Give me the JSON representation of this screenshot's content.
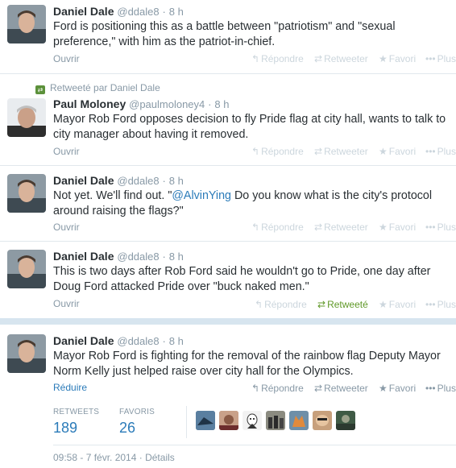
{
  "tweets": [
    {
      "name": "Daniel Dale",
      "handle": "@ddale8",
      "time": "8 h",
      "text": "Ford is positioning this as a battle between \"patriotism\" and \"sexual preference,\" with him as the patriot-in-chief.",
      "open_label": "Ouvrir",
      "reply": "Répondre",
      "retweet": "Retweeter",
      "favorite": "Favori",
      "more": "Plus"
    },
    {
      "retweeted_by": "Retweeté par Daniel Dale",
      "name": "Paul Moloney",
      "handle": "@paulmoloney4",
      "time": "8 h",
      "text": "Mayor Rob Ford opposes decision to fly Pride flag at city hall, wants to talk to city manager about having it removed.",
      "open_label": "Ouvrir",
      "reply": "Répondre",
      "retweet": "Retweeter",
      "favorite": "Favori",
      "more": "Plus"
    },
    {
      "name": "Daniel Dale",
      "handle": "@ddale8",
      "time": "8 h",
      "text_before": "Not yet. We'll find out. \"",
      "mention": "@AlvinYing",
      "text_after": " Do you know what is the city's protocol around raising the flags?\"",
      "open_label": "Ouvrir",
      "reply": "Répondre",
      "retweet": "Retweeter",
      "favorite": "Favori",
      "more": "Plus"
    },
    {
      "name": "Daniel Dale",
      "handle": "@ddale8",
      "time": "8 h",
      "text": "This is two days after Rob Ford said he wouldn't go to Pride, one day after Doug Ford attacked Pride over \"buck naked men.\"",
      "open_label": "Ouvrir",
      "reply": "Répondre",
      "retweet": "Retweeté",
      "favorite": "Favori",
      "more": "Plus"
    },
    {
      "name": "Daniel Dale",
      "handle": "@ddale8",
      "time": "8 h",
      "text": "Mayor Rob Ford is fighting for the removal of the rainbow flag Deputy Mayor Norm Kelly just helped raise over city hall for the Olympics.",
      "open_label": "Réduire",
      "reply": "Répondre",
      "retweet": "Retweeter",
      "favorite": "Favori",
      "more": "Plus"
    }
  ],
  "stats": {
    "retweets_label": "RETWEETS",
    "retweets_value": "189",
    "favorites_label": "FAVORIS",
    "favorites_value": "26"
  },
  "footer": {
    "timestamp": "09:58 - 7 févr. 2014",
    "separator": "·",
    "details": "Détails"
  },
  "colors": {
    "link": "#2b7bb9",
    "muted": "#8899a6",
    "retweeted": "#609928",
    "divider": "#d7e5ef"
  },
  "icons": [
    "reply-icon",
    "retweet-icon",
    "star-icon",
    "more-icon",
    "retweet-badge-icon"
  ]
}
